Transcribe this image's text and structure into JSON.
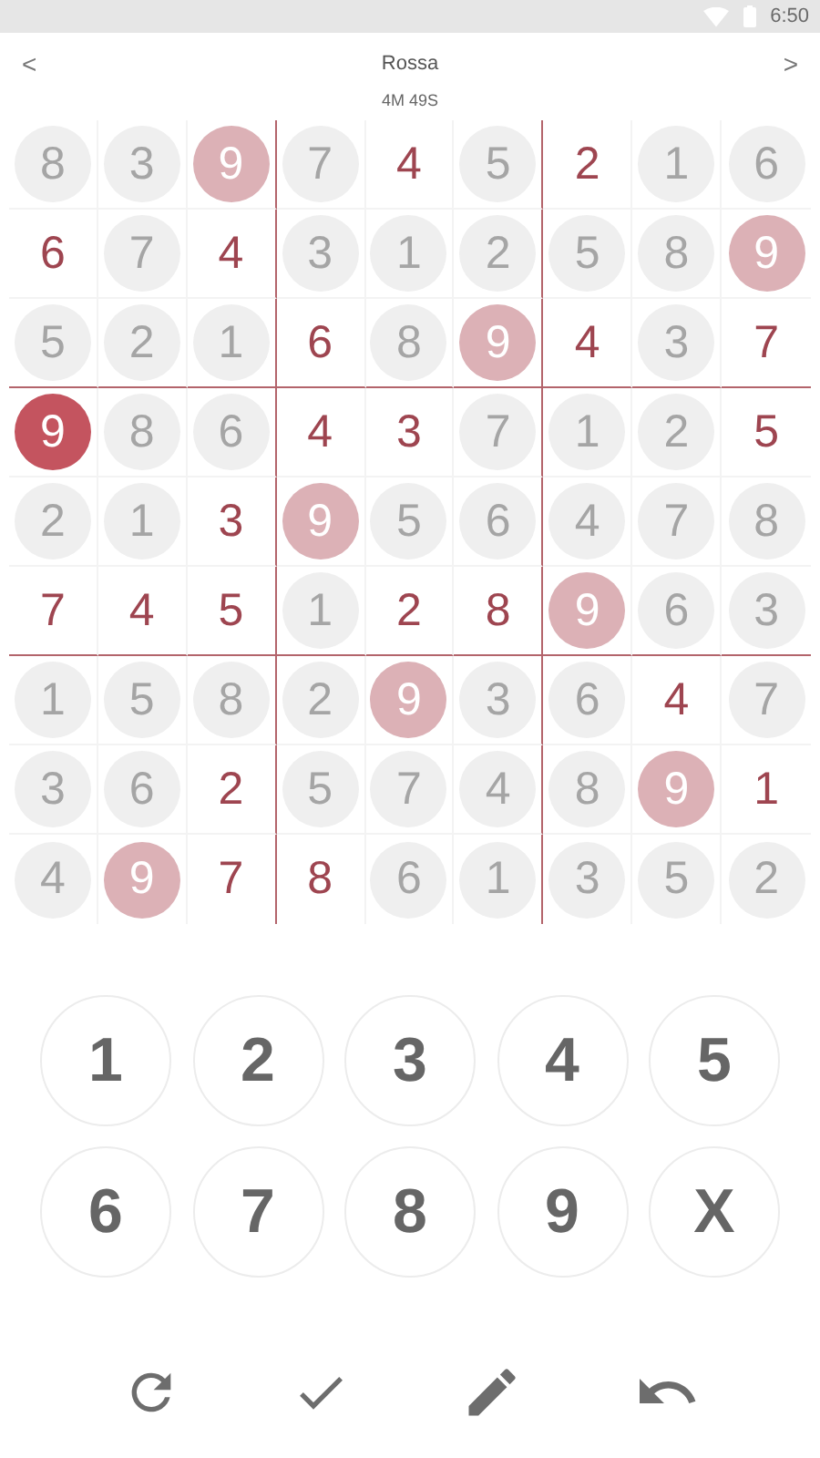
{
  "status_bar": {
    "time": "6:50"
  },
  "header": {
    "back": "<",
    "title": "Rossa",
    "forward": ">",
    "timer": "4M 49S"
  },
  "grid": [
    [
      {
        "v": "8",
        "kind": "given"
      },
      {
        "v": "3",
        "kind": "given"
      },
      {
        "v": "9",
        "kind": "match"
      },
      {
        "v": "7",
        "kind": "given"
      },
      {
        "v": "4",
        "kind": "entry"
      },
      {
        "v": "5",
        "kind": "given"
      },
      {
        "v": "2",
        "kind": "entry"
      },
      {
        "v": "1",
        "kind": "given"
      },
      {
        "v": "6",
        "kind": "given"
      }
    ],
    [
      {
        "v": "6",
        "kind": "entry"
      },
      {
        "v": "7",
        "kind": "given"
      },
      {
        "v": "4",
        "kind": "entry"
      },
      {
        "v": "3",
        "kind": "given"
      },
      {
        "v": "1",
        "kind": "given"
      },
      {
        "v": "2",
        "kind": "given"
      },
      {
        "v": "5",
        "kind": "given"
      },
      {
        "v": "8",
        "kind": "given"
      },
      {
        "v": "9",
        "kind": "match"
      }
    ],
    [
      {
        "v": "5",
        "kind": "given"
      },
      {
        "v": "2",
        "kind": "given"
      },
      {
        "v": "1",
        "kind": "given"
      },
      {
        "v": "6",
        "kind": "entry"
      },
      {
        "v": "8",
        "kind": "given"
      },
      {
        "v": "9",
        "kind": "match"
      },
      {
        "v": "4",
        "kind": "entry"
      },
      {
        "v": "3",
        "kind": "given"
      },
      {
        "v": "7",
        "kind": "entry"
      }
    ],
    [
      {
        "v": "9",
        "kind": "selected"
      },
      {
        "v": "8",
        "kind": "given"
      },
      {
        "v": "6",
        "kind": "given"
      },
      {
        "v": "4",
        "kind": "entry"
      },
      {
        "v": "3",
        "kind": "entry"
      },
      {
        "v": "7",
        "kind": "given"
      },
      {
        "v": "1",
        "kind": "given"
      },
      {
        "v": "2",
        "kind": "given"
      },
      {
        "v": "5",
        "kind": "entry"
      }
    ],
    [
      {
        "v": "2",
        "kind": "given"
      },
      {
        "v": "1",
        "kind": "given"
      },
      {
        "v": "3",
        "kind": "entry"
      },
      {
        "v": "9",
        "kind": "match"
      },
      {
        "v": "5",
        "kind": "given"
      },
      {
        "v": "6",
        "kind": "given"
      },
      {
        "v": "4",
        "kind": "given"
      },
      {
        "v": "7",
        "kind": "given"
      },
      {
        "v": "8",
        "kind": "given"
      }
    ],
    [
      {
        "v": "7",
        "kind": "entry"
      },
      {
        "v": "4",
        "kind": "entry"
      },
      {
        "v": "5",
        "kind": "entry"
      },
      {
        "v": "1",
        "kind": "given"
      },
      {
        "v": "2",
        "kind": "entry"
      },
      {
        "v": "8",
        "kind": "entry"
      },
      {
        "v": "9",
        "kind": "match"
      },
      {
        "v": "6",
        "kind": "given"
      },
      {
        "v": "3",
        "kind": "given"
      }
    ],
    [
      {
        "v": "1",
        "kind": "given"
      },
      {
        "v": "5",
        "kind": "given"
      },
      {
        "v": "8",
        "kind": "given"
      },
      {
        "v": "2",
        "kind": "given"
      },
      {
        "v": "9",
        "kind": "match"
      },
      {
        "v": "3",
        "kind": "given"
      },
      {
        "v": "6",
        "kind": "given"
      },
      {
        "v": "4",
        "kind": "entry"
      },
      {
        "v": "7",
        "kind": "given"
      }
    ],
    [
      {
        "v": "3",
        "kind": "given"
      },
      {
        "v": "6",
        "kind": "given"
      },
      {
        "v": "2",
        "kind": "entry"
      },
      {
        "v": "5",
        "kind": "given"
      },
      {
        "v": "7",
        "kind": "given"
      },
      {
        "v": "4",
        "kind": "given"
      },
      {
        "v": "8",
        "kind": "given"
      },
      {
        "v": "9",
        "kind": "match"
      },
      {
        "v": "1",
        "kind": "entry"
      }
    ],
    [
      {
        "v": "4",
        "kind": "given"
      },
      {
        "v": "9",
        "kind": "match"
      },
      {
        "v": "7",
        "kind": "entry"
      },
      {
        "v": "8",
        "kind": "entry"
      },
      {
        "v": "6",
        "kind": "given"
      },
      {
        "v": "1",
        "kind": "given"
      },
      {
        "v": "3",
        "kind": "given"
      },
      {
        "v": "5",
        "kind": "given"
      },
      {
        "v": "2",
        "kind": "given"
      }
    ]
  ],
  "keypad": [
    "1",
    "2",
    "3",
    "4",
    "5",
    "6",
    "7",
    "8",
    "9",
    "X"
  ],
  "toolbar": [
    {
      "kind": "restart"
    },
    {
      "kind": "check"
    },
    {
      "kind": "pencil"
    },
    {
      "kind": "undo"
    }
  ]
}
